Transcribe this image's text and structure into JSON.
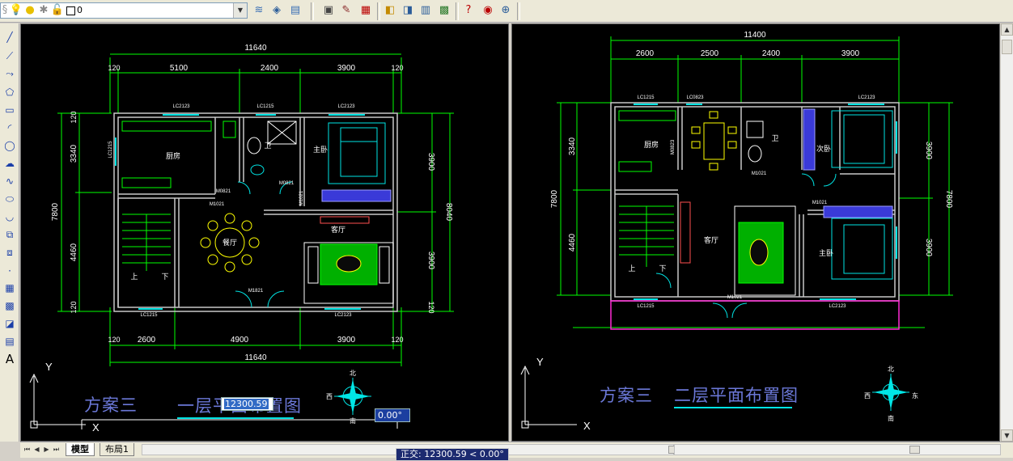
{
  "toolbar": {
    "layer_value": "0",
    "icons": [
      "lightbulb-icon",
      "sun-icon",
      "lock-icon",
      "color-swatch-icon",
      "layer-manager-icon",
      "layer-state-icon",
      "layer-previous-icon",
      "properties-icon",
      "design-center-icon",
      "tool-palettes-icon",
      "sheet-set-icon",
      "markup-icon",
      "calculator-icon",
      "help-icon",
      "web-icon"
    ]
  },
  "left_tools": [
    "line-icon",
    "construction-line-icon",
    "polyline-icon",
    "polygon-icon",
    "rectangle-icon",
    "arc-icon",
    "circle-icon",
    "revision-cloud-icon",
    "spline-icon",
    "ellipse-icon",
    "ellipse-arc-icon",
    "insert-block-icon",
    "make-block-icon",
    "point-icon",
    "hatch-icon",
    "gradient-icon",
    "region-icon",
    "table-icon",
    "text-icon"
  ],
  "left_tool_text": "A",
  "dynamic_input": {
    "distance": "12300.59",
    "angle": "0.00°"
  },
  "status_tip": "正交: 12300.59 < 0.00°",
  "tabs": [
    "模型",
    "布局1"
  ],
  "plan1": {
    "scheme": "方案三",
    "title": "一层平面布置图",
    "dim_total_top": "11640",
    "dim_total_bottom": "11640",
    "dims_top": [
      "120",
      "5100",
      "2400",
      "3900",
      "120"
    ],
    "dims_bottom": [
      "120",
      "2600",
      "4900",
      "3900",
      "120"
    ],
    "dims_left": [
      "120",
      "3340",
      "7800",
      "4460",
      "120"
    ],
    "dims_right": [
      "3900",
      "8040",
      "3900",
      "120"
    ],
    "window_tags": [
      "LC2123",
      "LC1215",
      "LC2123",
      "LC1215",
      "LC1215",
      "LC2123"
    ],
    "door_tags": [
      "M0821",
      "M0821",
      "M1021",
      "M1021",
      "M1821"
    ],
    "rooms": [
      "厨房",
      "卫",
      "主卧",
      "餐厅",
      "客厅",
      "上",
      "下"
    ],
    "compass": [
      "北",
      "南",
      "西"
    ]
  },
  "plan2": {
    "scheme": "方案三",
    "title": "二层平面布置图",
    "dim_total_top": "11400",
    "dims_top": [
      "2600",
      "2500",
      "2400",
      "3900"
    ],
    "dims_left": [
      "3340",
      "7800",
      "4460"
    ],
    "dims_right": [
      "3900",
      "7800",
      "3900"
    ],
    "window_tags": [
      "LC1215",
      "LC0823",
      "LC2123",
      "LC1215",
      "LC2123"
    ],
    "door_tags": [
      "M0823",
      "M1021",
      "M1021",
      "M1021"
    ],
    "rooms": [
      "厨房",
      "卫",
      "次卧",
      "客厅",
      "主卧",
      "上",
      "下"
    ],
    "compass": [
      "北",
      "南",
      "西",
      "东"
    ]
  },
  "axes": {
    "y": "Y",
    "x": "X"
  }
}
